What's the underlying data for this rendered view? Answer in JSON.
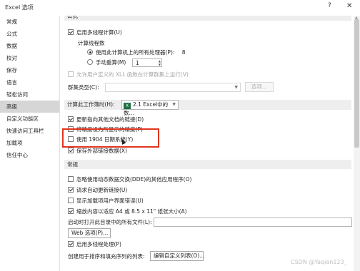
{
  "window": {
    "title": "Excel 选项",
    "help_label": "?",
    "close_label": "✕"
  },
  "sidebar": {
    "items": [
      {
        "label": "常规",
        "active": false
      },
      {
        "label": "公式",
        "active": false
      },
      {
        "label": "数据",
        "active": false
      },
      {
        "label": "校对",
        "active": false
      },
      {
        "label": "保存",
        "active": false
      },
      {
        "label": "语言",
        "active": false
      },
      {
        "label": "轻松访问",
        "active": false
      },
      {
        "label": "高级",
        "active": true
      },
      {
        "label": "自定义功能区",
        "active": false
      },
      {
        "label": "快速访问工具栏",
        "active": false
      },
      {
        "label": "加载项",
        "active": false
      },
      {
        "label": "信任中心",
        "active": false
      }
    ]
  },
  "formulas_section": {
    "header": "公式",
    "multithread_label": "启用多线程计算(U)",
    "thread_count_label": "计算线程数",
    "use_all_processors_label": "使用此计算机上的所有处理器(P):",
    "processor_count": "8",
    "manual_label": "手动重算(M)",
    "manual_value": "1",
    "xll_label": "允许用户定义的 XLL 函数在计算群集上运行(V)",
    "cluster_type_label": "群集类型(C):",
    "cluster_select_value": "",
    "options_button": "选项..."
  },
  "workbook_calc": {
    "label": "计算此工作簿时(H):",
    "workbook_icon_text": "X",
    "workbook_value": "2.1 Excel中的数...",
    "items": [
      {
        "label": "更新指向其他文档的链接(D)",
        "checked": true
      },
      {
        "label": "将精度设为所显示的精度(P)",
        "checked": false
      },
      {
        "label": "使用 1904 日期系统(Y)",
        "checked": false
      },
      {
        "label": "保存外部链接数据(X)",
        "checked": true
      }
    ]
  },
  "general_section": {
    "header": "常规",
    "items": [
      {
        "label": "忽略使用动态数据交换(DDE)的其他应用程序(O)",
        "checked": false
      },
      {
        "label": "请求自动更新链接(U)",
        "checked": true
      },
      {
        "label": "显示加载项用户界面错误(U)",
        "checked": false
      },
      {
        "label": "缩放内容以适应 A4 或 8.5 x 11\" 纸张大小(A)",
        "checked": true
      }
    ],
    "startup_folder_label": "启动时打开此目录中的所有文件(L):",
    "startup_folder_value": "",
    "web_options_button": "Web 选项(P)...",
    "multithread_processing_label": "启用多线程处理(P)",
    "custom_lists_label": "创建用于排序和填充序列的列表:",
    "edit_custom_lists_button": "编辑自定义列表(O)..."
  },
  "watermark": "CSDN @Yaqian123_",
  "colors": {
    "highlight": "#e0341e",
    "active_nav": "#d6d6d6",
    "section_bg": "#eeeeee",
    "excel_green": "#1d6f42"
  }
}
